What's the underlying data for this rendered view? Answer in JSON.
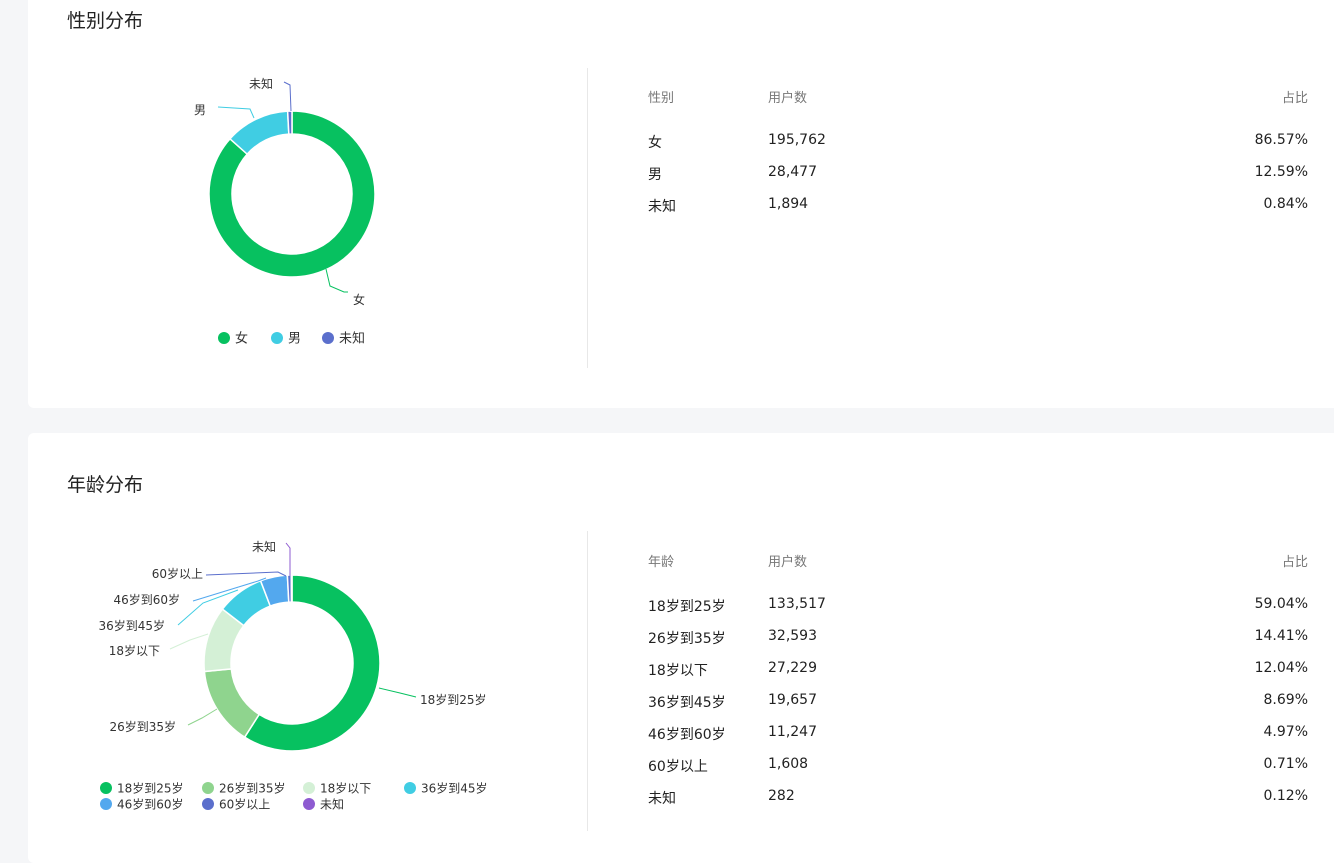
{
  "gender": {
    "title": "性别分布",
    "table_headers": [
      "性别",
      "用户数",
      "占比"
    ],
    "rows": [
      {
        "label": "女",
        "count": "195,762",
        "pct": "86.57%"
      },
      {
        "label": "男",
        "count": "28,477",
        "pct": "12.59%"
      },
      {
        "label": "未知",
        "count": "1,894",
        "pct": "0.84%"
      }
    ]
  },
  "age": {
    "title": "年龄分布",
    "table_headers": [
      "年龄",
      "用户数",
      "占比"
    ],
    "rows": [
      {
        "label": "18岁到25岁",
        "count": "133,517",
        "pct": "59.04%"
      },
      {
        "label": "26岁到35岁",
        "count": "32,593",
        "pct": "14.41%"
      },
      {
        "label": "18岁以下",
        "count": "27,229",
        "pct": "12.04%"
      },
      {
        "label": "36岁到45岁",
        "count": "19,657",
        "pct": "8.69%"
      },
      {
        "label": "46岁到60岁",
        "count": "11,247",
        "pct": "4.97%"
      },
      {
        "label": "60岁以上",
        "count": "1,608",
        "pct": "0.71%"
      },
      {
        "label": "未知",
        "count": "282",
        "pct": "0.12%"
      }
    ]
  },
  "chart_data": [
    {
      "type": "pie",
      "subtype": "donut",
      "categories": [
        "女",
        "男",
        "未知"
      ],
      "values": [
        195762,
        28477,
        1894
      ],
      "colors": [
        "#07c160",
        "#40cde3",
        "#5b6fcc"
      ],
      "legend": "bottom"
    },
    {
      "type": "pie",
      "subtype": "donut",
      "categories": [
        "18岁到25岁",
        "26岁到35岁",
        "18岁以下",
        "36岁到45岁",
        "46岁到60岁",
        "60岁以上",
        "未知"
      ],
      "values": [
        133517,
        32593,
        27229,
        19657,
        11247,
        1608,
        282
      ],
      "colors": [
        "#07c160",
        "#8fd48e",
        "#d4f0d6",
        "#40cde3",
        "#53a8ee",
        "#5b6fcc",
        "#8e5bd1"
      ],
      "legend": "bottom"
    }
  ]
}
